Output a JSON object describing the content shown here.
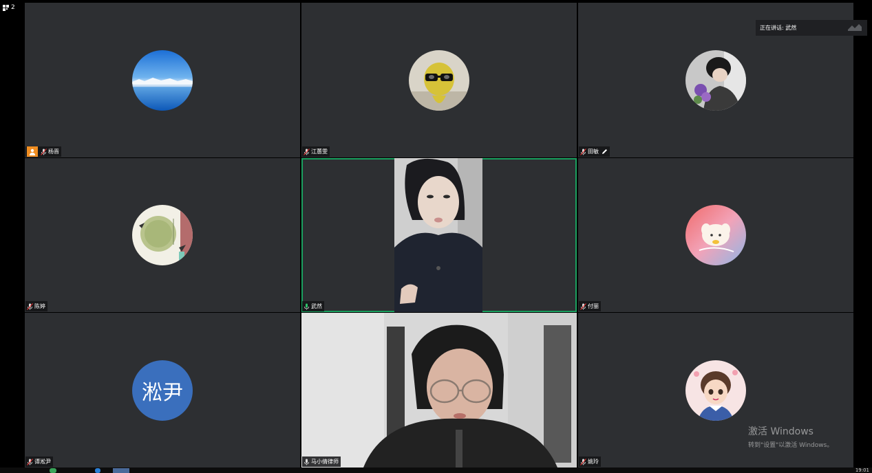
{
  "page_indicator": {
    "count": "2"
  },
  "speaking": {
    "label": "正在讲话: 武然"
  },
  "participants": [
    {
      "name": "杨晋",
      "host": true
    },
    {
      "name": "江蕙雯"
    },
    {
      "name": "田敏"
    },
    {
      "name": "陈婷"
    },
    {
      "name": "武然"
    },
    {
      "name": "付丽"
    },
    {
      "name": "谭淞尹",
      "avatar_text": "淞尹"
    },
    {
      "name": "马小倩律师"
    },
    {
      "name": "姚玲"
    }
  ],
  "watermark": {
    "title": "激活 Windows",
    "subtitle": "转到\"设置\"以激活 Windows。"
  },
  "taskbar": {
    "clock": "19:01"
  },
  "colors": {
    "tile_bg": "#2d2f32",
    "active_border": "#1aa160",
    "host_badge": "#f08d21",
    "avatar_text_bg": "#3a6fbd"
  }
}
